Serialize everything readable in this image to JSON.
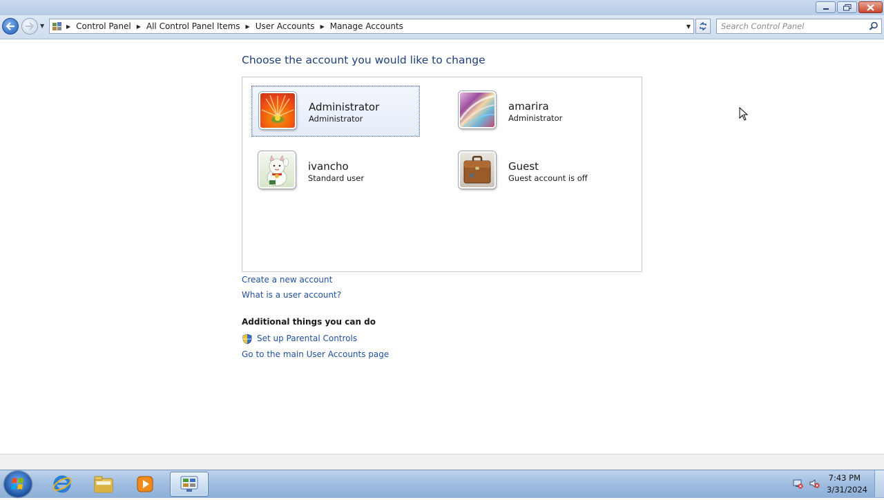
{
  "window": {
    "controls": {
      "minimize_icon": "minimize-icon",
      "maximize_icon": "restore-icon",
      "close_icon": "close-icon"
    }
  },
  "navbar": {
    "breadcrumbs": [
      "Control Panel",
      "All Control Panel Items",
      "User Accounts",
      "Manage Accounts"
    ],
    "search_placeholder": "Search Control Panel"
  },
  "main": {
    "heading": "Choose the account you would like to change",
    "accounts": [
      {
        "name": "Administrator",
        "type": "Administrator",
        "avatar": "flower",
        "selected": true
      },
      {
        "name": "amarira",
        "type": "Administrator",
        "avatar": "abstract",
        "selected": false
      },
      {
        "name": "ivancho",
        "type": "Standard user",
        "avatar": "lucky-cat",
        "selected": false
      },
      {
        "name": "Guest",
        "type": "Guest account is off",
        "avatar": "briefcase",
        "selected": false
      }
    ],
    "links": {
      "create_account": "Create a new account",
      "what_is_account": "What is a user account?"
    },
    "additional": {
      "heading": "Additional things you can do",
      "parental_controls": "Set up Parental Controls",
      "main_page": "Go to the main User Accounts page"
    }
  },
  "taskbar": {
    "clock_time": "7:43 PM",
    "clock_date": "3/31/2024"
  },
  "colors": {
    "link": "#1f4f9f",
    "heading": "#1e3f7a",
    "taskbar": "#9fbcdf"
  }
}
